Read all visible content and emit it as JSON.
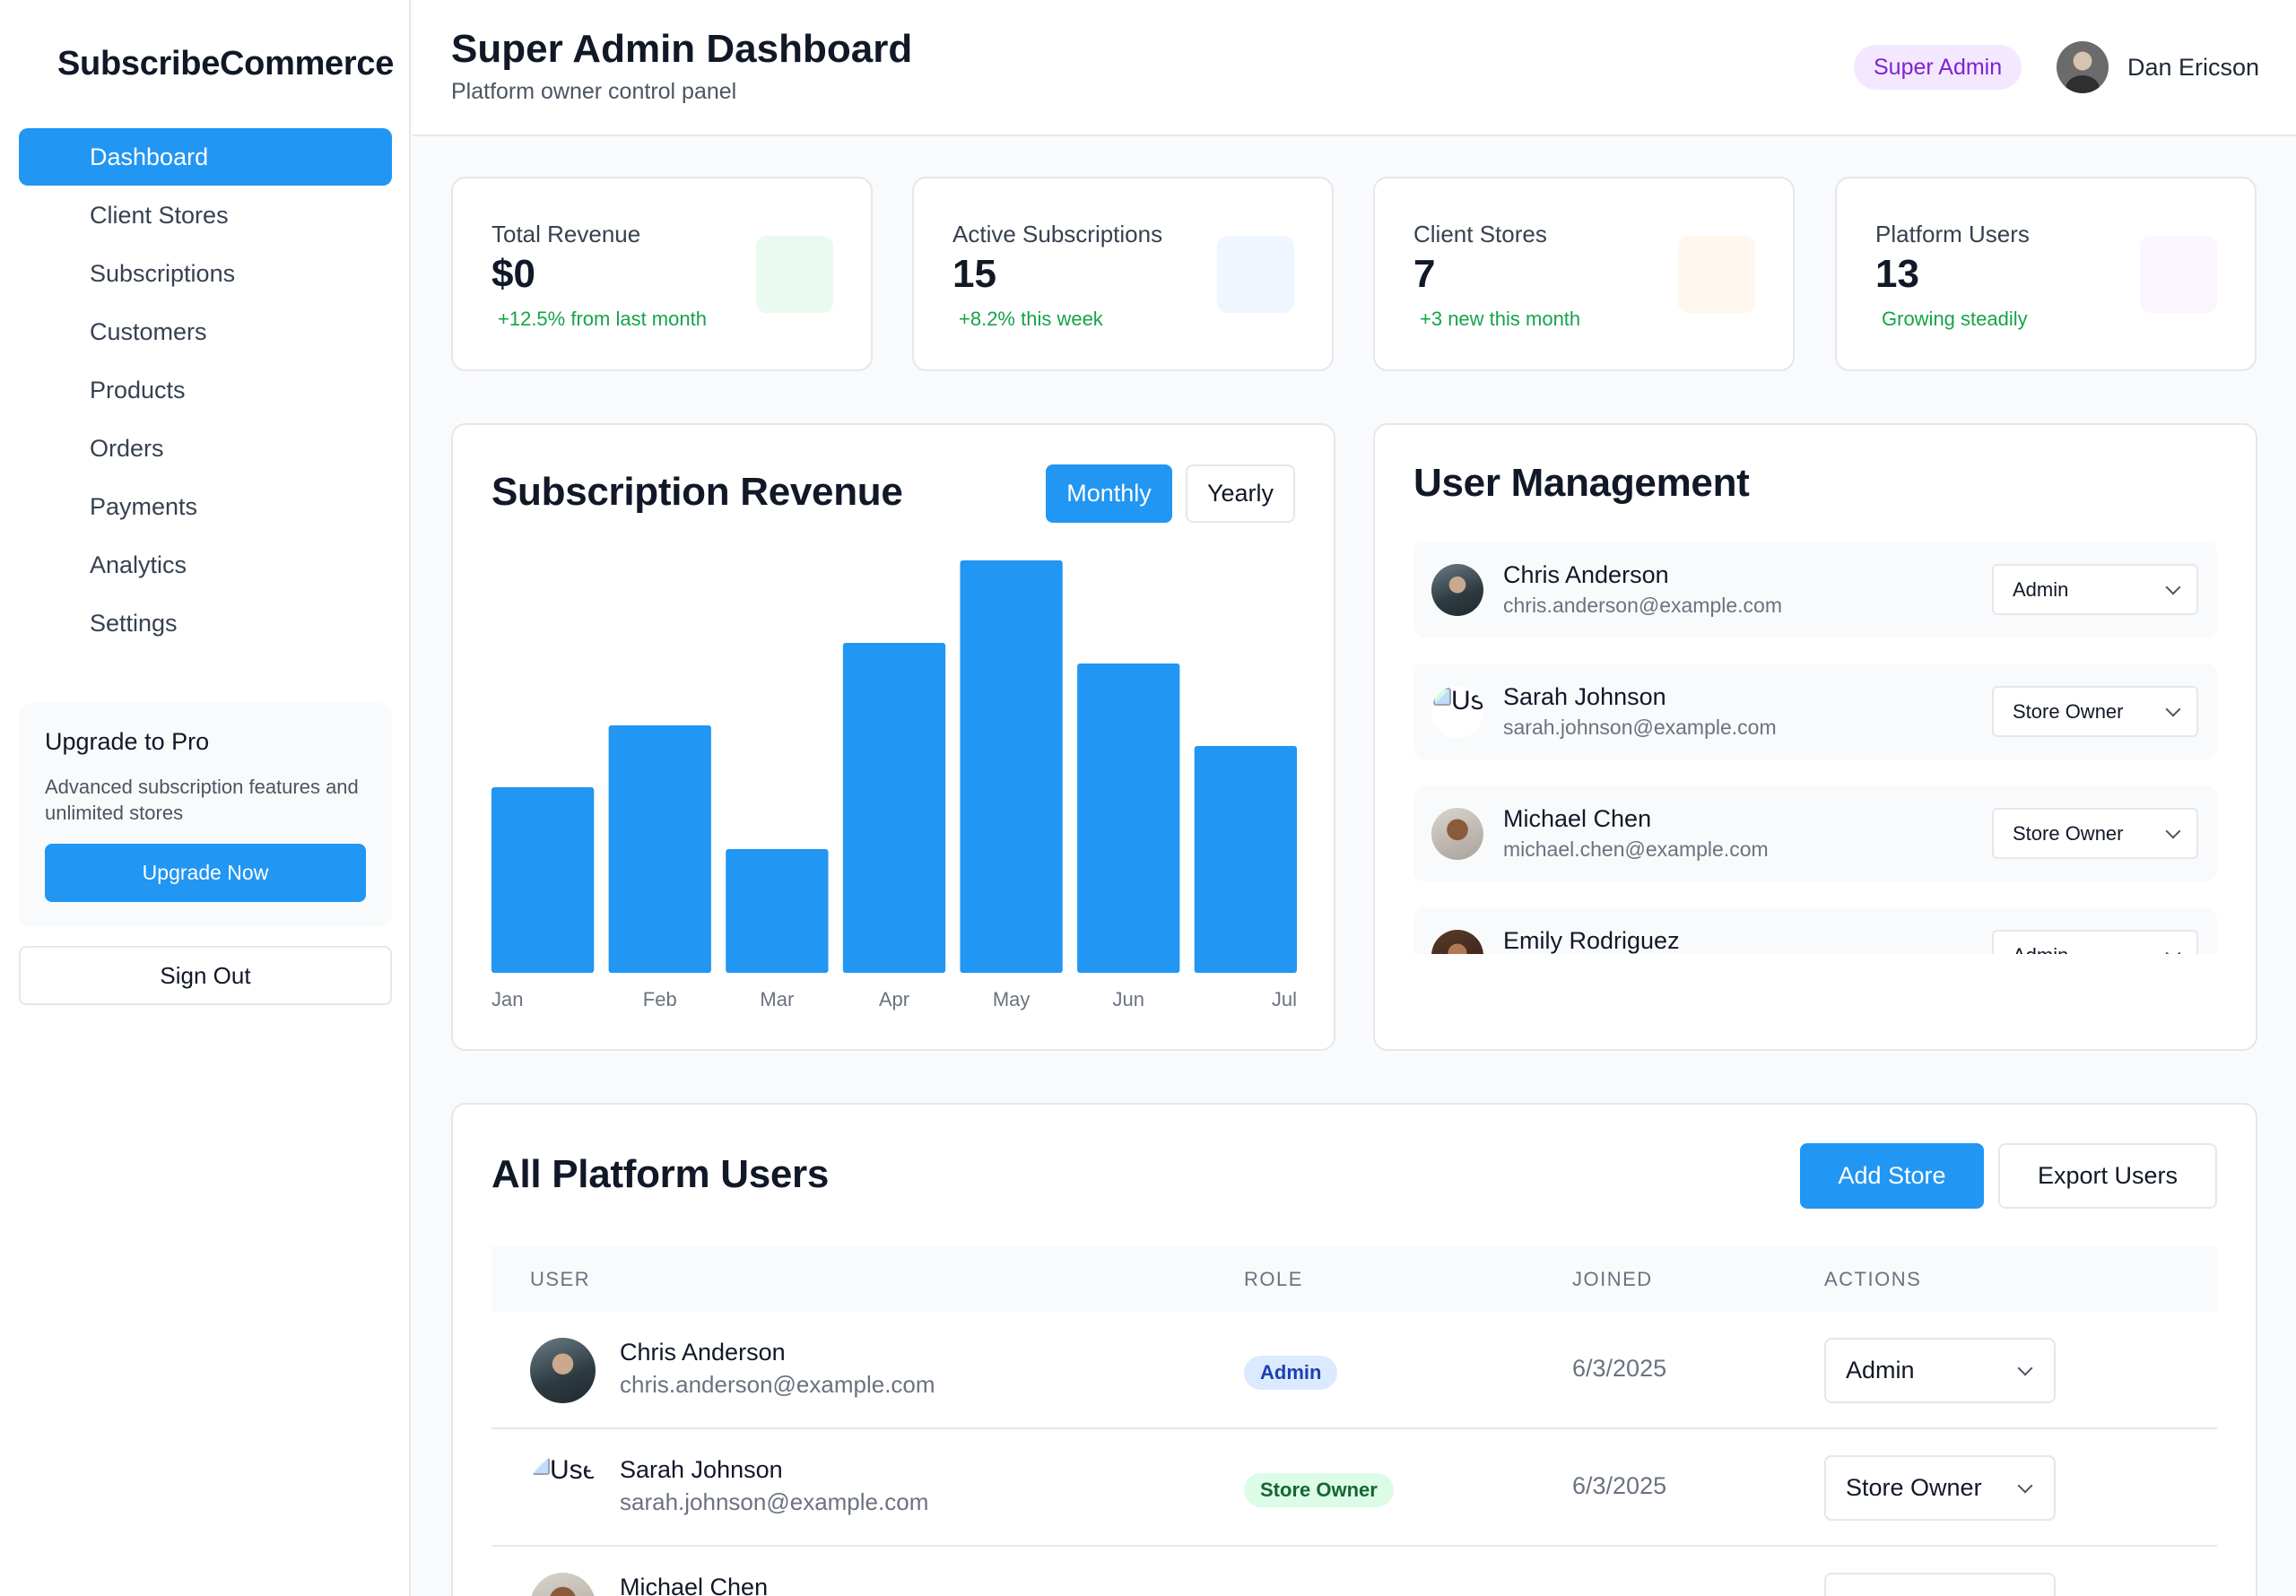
{
  "sidebar": {
    "brand": "SubscribeCommerce",
    "items": [
      {
        "label": "Dashboard",
        "active": true
      },
      {
        "label": "Client Stores"
      },
      {
        "label": "Subscriptions"
      },
      {
        "label": "Customers"
      },
      {
        "label": "Products"
      },
      {
        "label": "Orders"
      },
      {
        "label": "Payments"
      },
      {
        "label": "Analytics"
      },
      {
        "label": "Settings"
      }
    ],
    "upgrade": {
      "title": "Upgrade to Pro",
      "description": "Advanced subscription features and unlimited stores",
      "button": "Upgrade Now"
    },
    "sign_out": "Sign Out"
  },
  "header": {
    "title": "Super Admin Dashboard",
    "subtitle": "Platform owner control panel",
    "role_badge": "Super Admin",
    "user_name": "Dan Ericson"
  },
  "stats": [
    {
      "label": "Total Revenue",
      "value": "$0",
      "trend": "+12.5% from last month",
      "icon_color": "#eafaf0"
    },
    {
      "label": "Active Subscriptions",
      "value": "15",
      "trend": "+8.2% this week",
      "icon_color": "#eff6ff"
    },
    {
      "label": "Client Stores",
      "value": "7",
      "trend": "+3 new this month",
      "icon_color": "#fff7ed"
    },
    {
      "label": "Platform Users",
      "value": "13",
      "trend": "Growing steadily",
      "icon_color": "#faf5ff"
    }
  ],
  "revenue": {
    "title": "Subscription Revenue",
    "toggle": {
      "monthly": "Monthly",
      "yearly": "Yearly",
      "selected": "Monthly"
    }
  },
  "chart_data": {
    "type": "bar",
    "title": "Subscription Revenue",
    "categories": [
      "Jan",
      "Feb",
      "Mar",
      "Apr",
      "May",
      "Jun",
      "Jul"
    ],
    "values": [
      45,
      60,
      30,
      80,
      100,
      75,
      55
    ],
    "ylim": [
      0,
      100
    ],
    "grid": false,
    "color": "#2196f3"
  },
  "user_management": {
    "title": "User Management",
    "users": [
      {
        "name": "Chris Anderson",
        "email": "chris.anderson@example.com",
        "role": "Admin"
      },
      {
        "name": "Sarah Johnson",
        "email": "sarah.johnson@example.com",
        "role": "Store Owner"
      },
      {
        "name": "Michael Chen",
        "email": "michael.chen@example.com",
        "role": "Store Owner"
      },
      {
        "name": "Emily Rodriguez",
        "email": "",
        "role": "Admin"
      }
    ],
    "broken_avatar_alt": "Use"
  },
  "platform_users": {
    "title": "All Platform Users",
    "add_button": "Add Store",
    "export_button": "Export Users",
    "columns": [
      "USER",
      "ROLE",
      "JOINED",
      "ACTIONS"
    ],
    "rows": [
      {
        "name": "Chris Anderson",
        "email": "chris.anderson@example.com",
        "role": "Admin",
        "joined": "6/3/2025",
        "action": "Admin"
      },
      {
        "name": "Sarah Johnson",
        "email": "sarah.johnson@example.com",
        "role": "Store Owner",
        "joined": "6/3/2025",
        "action": "Store Owner"
      },
      {
        "name": "Michael Chen",
        "email": "",
        "role": "",
        "joined": "",
        "action": ""
      }
    ],
    "broken_avatar_alt": "Use"
  },
  "colors": {
    "accent": "#2196f3",
    "role_badge_bg": "#f3e8ff",
    "role_badge_text": "#7e22ce",
    "trend_green": "#16a34a"
  }
}
